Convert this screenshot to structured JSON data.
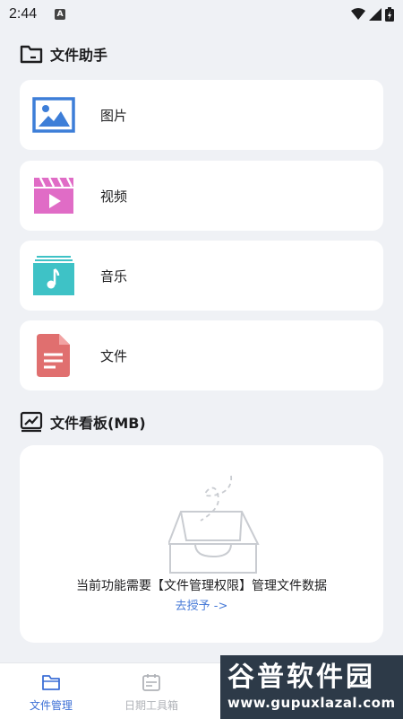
{
  "status_bar": {
    "time": "2:44",
    "a_badge": "A"
  },
  "file_helper": {
    "title": "文件助手",
    "items": [
      {
        "label": "图片",
        "icon": "image-icon"
      },
      {
        "label": "视频",
        "icon": "video-icon"
      },
      {
        "label": "音乐",
        "icon": "music-icon"
      },
      {
        "label": "文件",
        "icon": "document-icon"
      }
    ]
  },
  "file_board": {
    "title": "文件看板(MB)",
    "empty_message": "当前功能需要【文件管理权限】管理文件数据",
    "grant_link": "去授予 ->"
  },
  "bottom_nav": {
    "items": [
      {
        "label": "文件管理",
        "active": true
      },
      {
        "label": "日期工具箱",
        "active": false
      }
    ]
  },
  "watermark": {
    "title": "谷普软件园",
    "url": "www.gupuxlazal.com"
  },
  "colors": {
    "accent": "#3c6fd6",
    "image_icon": "#3d7ed8",
    "video_icon": "#e06cc6",
    "music_icon": "#3ec2c6",
    "document_icon": "#e06f6f",
    "background": "#eff1f5"
  }
}
